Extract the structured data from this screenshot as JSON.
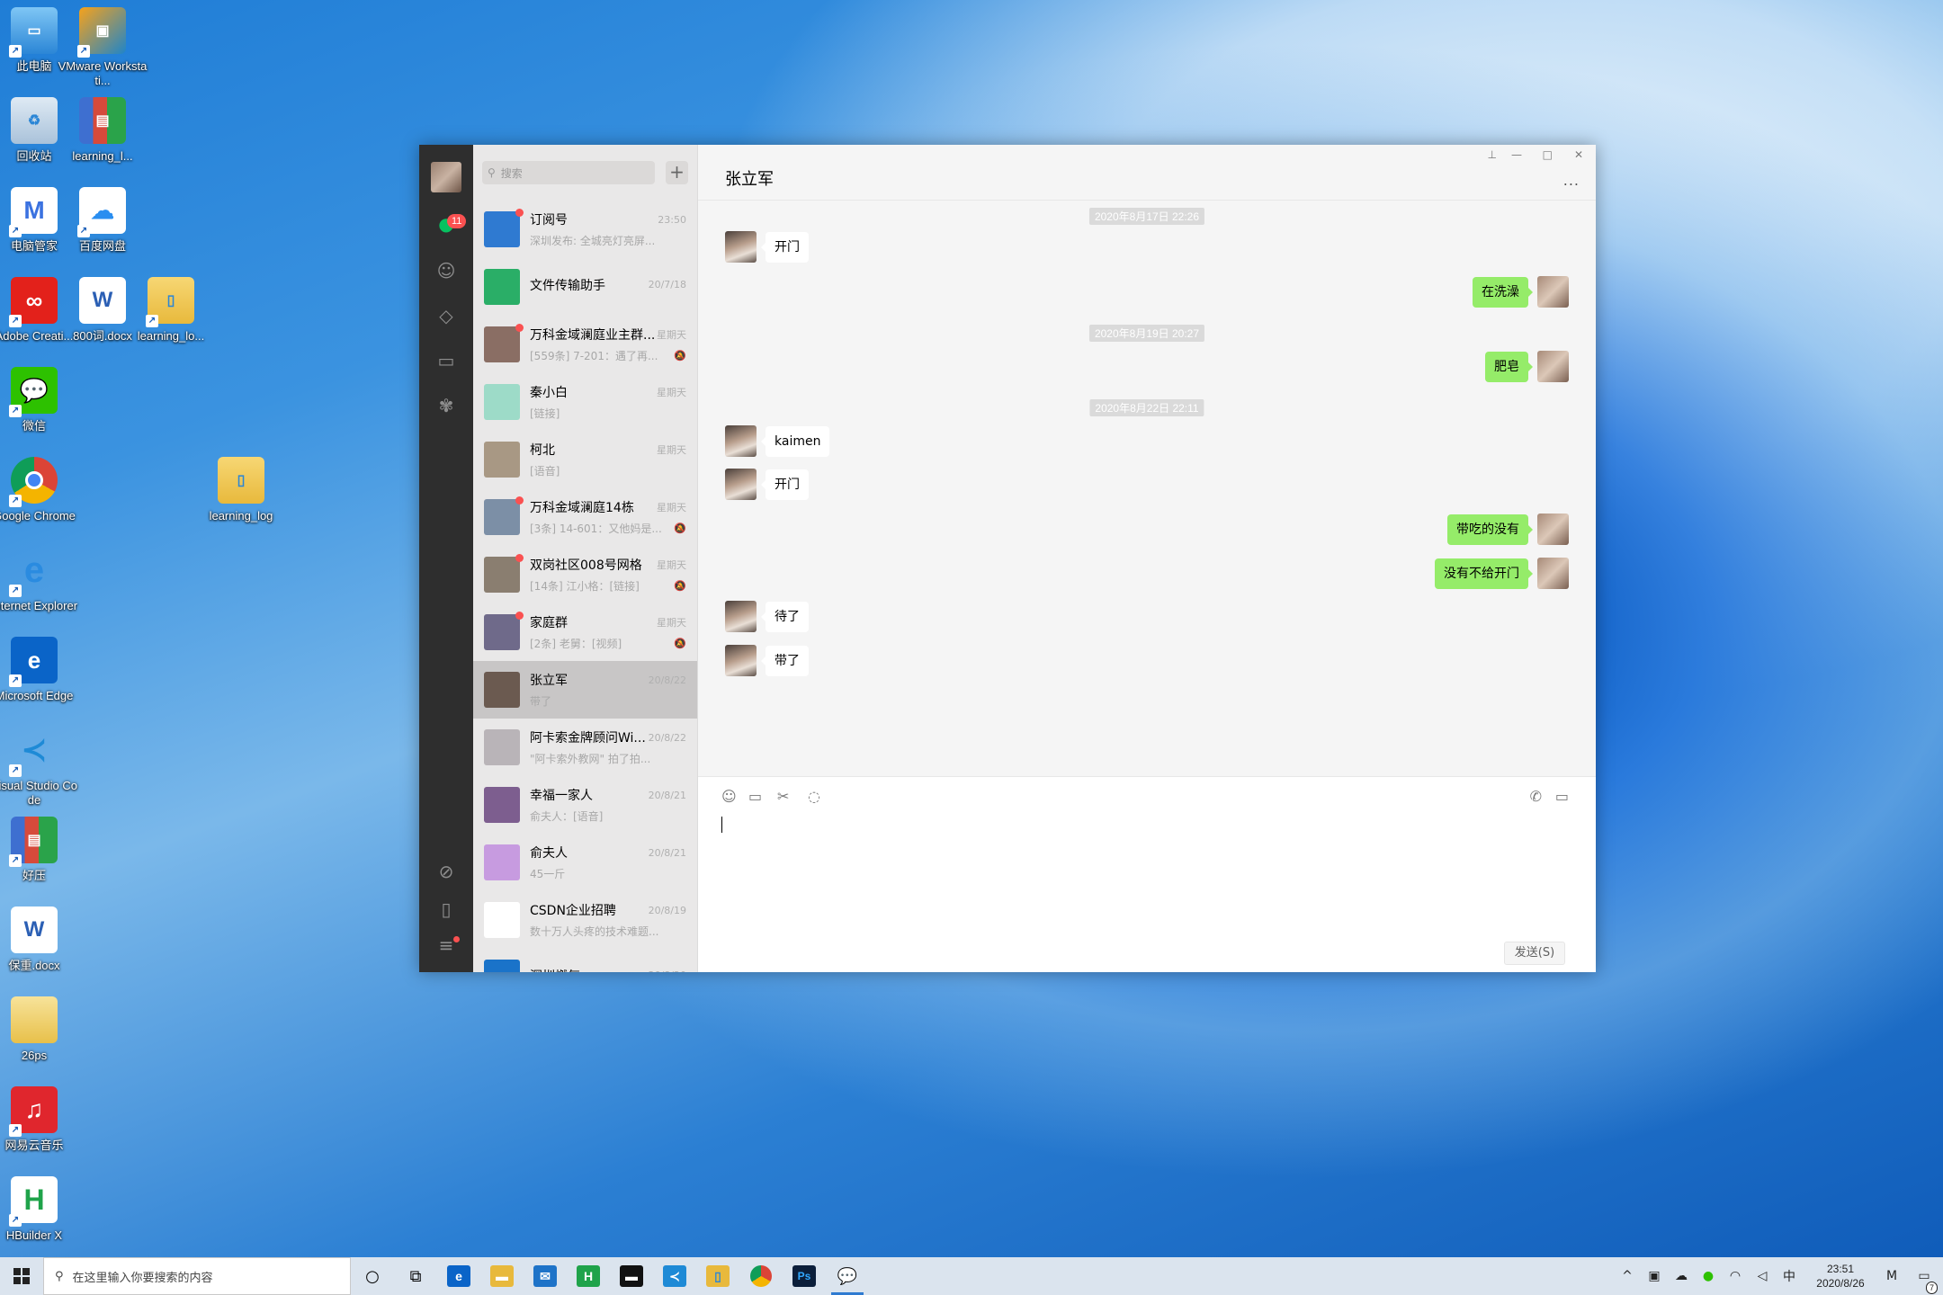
{
  "desktop": {
    "icons": [
      {
        "label": "此电脑"
      },
      {
        "label": "VMware Workstati..."
      },
      {
        "label": "回收站"
      },
      {
        "label": "learning_l..."
      },
      {
        "label": "电脑管家"
      },
      {
        "label": "百度网盘"
      },
      {
        "label": "Adobe Creati..."
      },
      {
        "label": "800词.docx"
      },
      {
        "label": "learning_lo..."
      },
      {
        "label": "微信"
      },
      {
        "label": "Google Chrome"
      },
      {
        "label": "learning_log"
      },
      {
        "label": "Internet Explorer"
      },
      {
        "label": "Microsoft Edge"
      },
      {
        "label": "Visual Studio Code"
      },
      {
        "label": "好压"
      },
      {
        "label": "保重.docx"
      },
      {
        "label": "26ps"
      },
      {
        "label": "网易云音乐"
      },
      {
        "label": "HBuilder X"
      }
    ]
  },
  "wechat": {
    "sidebar": {
      "chat_badge": "11"
    },
    "search": {
      "placeholder": "搜索"
    },
    "conversations": [
      {
        "name": "订阅号",
        "time": "23:50",
        "preview": "深圳发布: 全城亮灯亮屏...",
        "dot": true,
        "muted": false,
        "active": false,
        "avatar_color": "#2f7ad1"
      },
      {
        "name": "文件传输助手",
        "time": "20/7/18",
        "preview": "",
        "dot": false,
        "muted": false,
        "active": false,
        "avatar_color": "#2aae67"
      },
      {
        "name": "万科金域澜庭业主群...",
        "time": "星期天",
        "preview": "[559条] 7-201：遇了再...",
        "dot": true,
        "muted": true,
        "active": false,
        "avatar_color": "#8a6e64"
      },
      {
        "name": "秦小白",
        "time": "星期天",
        "preview": "[链接]",
        "dot": false,
        "muted": false,
        "active": false,
        "avatar_color": "#9ddbc8"
      },
      {
        "name": "柯北",
        "time": "星期天",
        "preview": "[语音]",
        "dot": false,
        "muted": false,
        "active": false,
        "avatar_color": "#a89884"
      },
      {
        "name": "万科金域澜庭14栋",
        "time": "星期天",
        "preview": "[3条] 14-601：又他妈是...",
        "dot": true,
        "muted": true,
        "active": false,
        "avatar_color": "#7c8fa6"
      },
      {
        "name": "双岗社区008号网格",
        "time": "星期天",
        "preview": "[14条] 江小格：[链接]",
        "dot": true,
        "muted": true,
        "active": false,
        "avatar_color": "#8a7e70"
      },
      {
        "name": "家庭群",
        "time": "星期天",
        "preview": "[2条] 老舅：[视频]",
        "dot": true,
        "muted": true,
        "active": false,
        "avatar_color": "#6f6a8a"
      },
      {
        "name": "张立军",
        "time": "20/8/22",
        "preview": "带了",
        "dot": false,
        "muted": false,
        "active": true,
        "avatar_color": "#6b5a50"
      },
      {
        "name": "阿卡索金牌顾问Wi...",
        "time": "20/8/22",
        "preview": "\"阿卡索外教网\" 拍了拍...",
        "dot": false,
        "muted": false,
        "active": false,
        "avatar_color": "#b9b4b8"
      },
      {
        "name": "幸福一家人",
        "time": "20/8/21",
        "preview": "俞夫人：[语音]",
        "dot": false,
        "muted": false,
        "active": false,
        "avatar_color": "#7d5e8f"
      },
      {
        "name": "俞夫人",
        "time": "20/8/21",
        "preview": "45一斤",
        "dot": false,
        "muted": false,
        "active": false,
        "avatar_color": "#c79be0"
      },
      {
        "name": "CSDN企业招聘",
        "time": "20/8/19",
        "preview": "数十万人头疼的技术难题...",
        "dot": false,
        "muted": false,
        "active": false,
        "avatar_color": "#ffffff"
      },
      {
        "name": "深圳燃气",
        "time": "20/8/20",
        "preview": "",
        "dot": false,
        "muted": false,
        "active": false,
        "avatar_color": "#1a73c9"
      }
    ],
    "chat": {
      "title": "张立军",
      "more": "...",
      "timestamps": [
        "2020年8月17日 22:26",
        "2020年8月19日 20:27",
        "2020年8月22日 22:11"
      ],
      "messages": [
        {
          "side": "left",
          "text": "开门"
        },
        {
          "side": "right",
          "text": "在洗澡"
        },
        {
          "side": "right",
          "text": "肥皂"
        },
        {
          "side": "left",
          "text": "kaimen"
        },
        {
          "side": "left",
          "text": "开门"
        },
        {
          "side": "right",
          "text": "带吃的没有"
        },
        {
          "side": "right",
          "text": "没有不给开门"
        },
        {
          "side": "left",
          "text": "待了"
        },
        {
          "side": "left",
          "text": "带了"
        }
      ],
      "send_label": "发送(S)"
    }
  },
  "taskbar": {
    "search_placeholder": "在这里输入你要搜索的内容",
    "ime": "中",
    "time": "23:51",
    "date": "2020/8/26",
    "notification_count": "7"
  }
}
